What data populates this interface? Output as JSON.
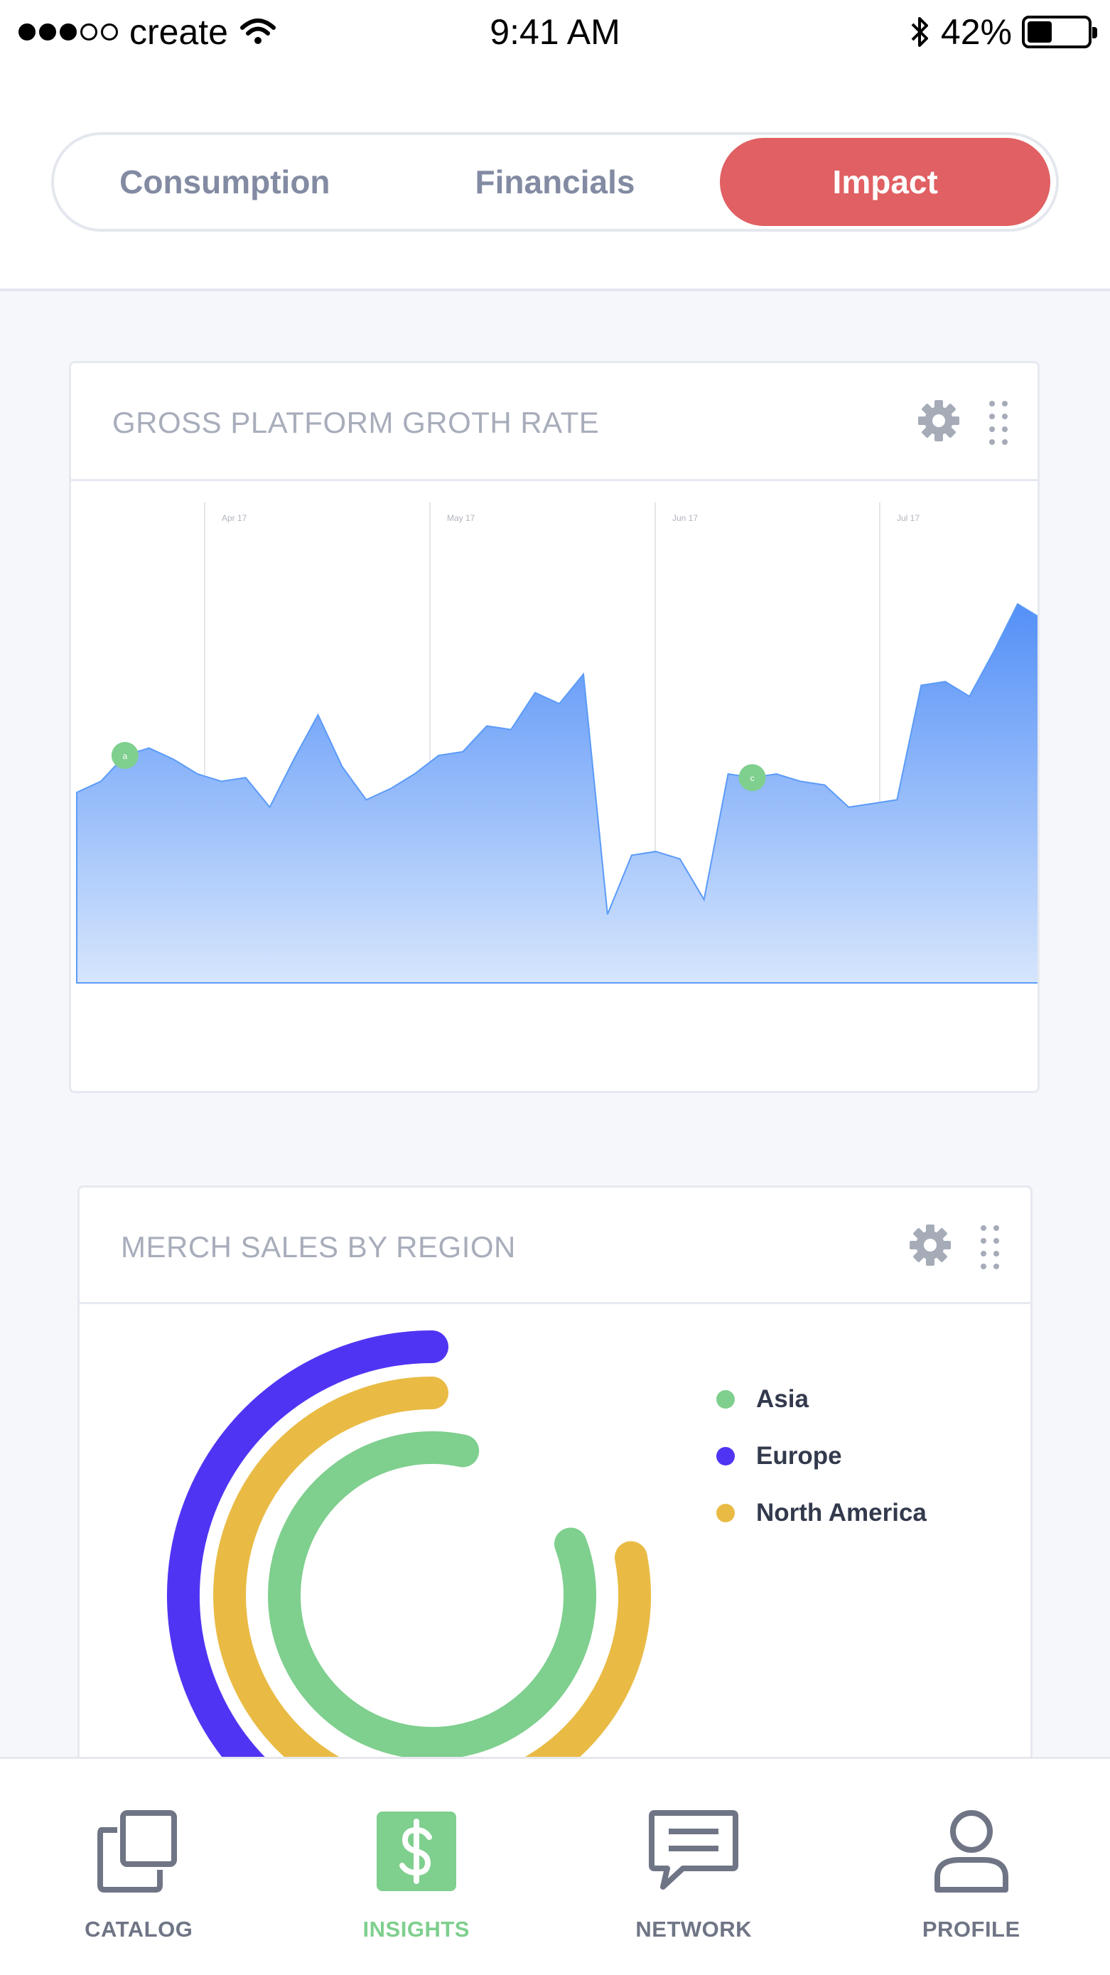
{
  "status_bar": {
    "carrier": "create",
    "time": "9:41 AM",
    "battery": "42%",
    "battery_level": 0.42
  },
  "segmented_control": {
    "tabs": [
      {
        "label": "Consumption",
        "active": false
      },
      {
        "label": "Financials",
        "active": false
      },
      {
        "label": "Impact",
        "active": true
      }
    ],
    "active_color": "#e06063"
  },
  "growth_card": {
    "title": "GROSS PLATFORM GROTH RATE",
    "gear_icon": "gear-icon",
    "drag_icon": "drag-handle-icon",
    "chart_data": {
      "type": "area",
      "title": "GROSS PLATFORM GROTH RATE",
      "x_tick_labels": [
        "Apr 17",
        "May 17",
        "Jun 17",
        "Jul 17"
      ],
      "y_range": [
        0,
        1
      ],
      "grid": "vertical",
      "series": [
        {
          "color": "#5b9bf8",
          "values": [
            0.35,
            0.38,
            0.45,
            0.47,
            0.44,
            0.4,
            0.38,
            0.39,
            0.31,
            0.44,
            0.56,
            0.42,
            0.33,
            0.36,
            0.4,
            0.45,
            0.46,
            0.53,
            0.52,
            0.62,
            0.59,
            0.67,
            0.02,
            0.18,
            0.19,
            0.17,
            0.06,
            0.4,
            0.39,
            0.4,
            0.38,
            0.37,
            0.31,
            0.32,
            0.33,
            0.64,
            0.65,
            0.61,
            0.73,
            0.86,
            0.82
          ]
        }
      ],
      "annotations": [
        {
          "label": "a",
          "index": 2
        },
        {
          "label": "c",
          "index": 28
        }
      ]
    }
  },
  "region_card": {
    "title": "MERCH SALES BY REGION",
    "gear_icon": "gear-icon",
    "drag_icon": "drag-handle-icon",
    "chart_data": {
      "type": "pie",
      "style": "concentric-rings",
      "title": "MERCH SALES BY REGION",
      "legend_position": "top-right",
      "series": [
        {
          "name": "Asia",
          "color": "#7fcf8e",
          "value": 0.84
        },
        {
          "name": "Europe",
          "color": "#4f35f3",
          "value": 0.62
        },
        {
          "name": "North America",
          "color": "#e9bb45",
          "value": 0.78
        }
      ]
    }
  },
  "tab_bar": {
    "items": [
      {
        "label": "CATALOG",
        "icon": "catalog-icon",
        "active": false
      },
      {
        "label": "INSIGHTS",
        "icon": "dollar-icon",
        "active": true
      },
      {
        "label": "NETWORK",
        "icon": "chat-bubble-icon",
        "active": false
      },
      {
        "label": "PROFILE",
        "icon": "person-icon",
        "active": false
      }
    ],
    "active_color": "#7fcf8e"
  }
}
